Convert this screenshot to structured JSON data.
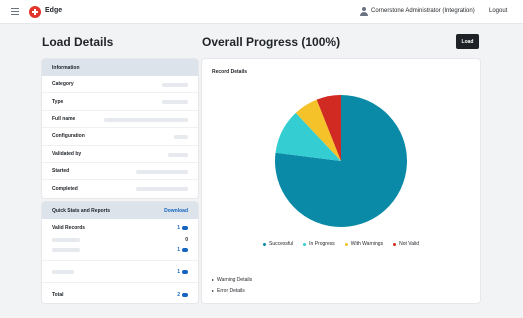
{
  "header": {
    "brand": "Edge",
    "user": "Cornerstone Administrator (Integration)",
    "logout": "Logout"
  },
  "page": {
    "title": "Load Details",
    "progress_title": "Overall Progress (100%)",
    "load_button": "Load"
  },
  "information": {
    "title": "Information",
    "rows": [
      {
        "label": "Category"
      },
      {
        "label": "Type"
      },
      {
        "label": "Full name"
      },
      {
        "label": "Configuration"
      },
      {
        "label": "Validated by"
      },
      {
        "label": "Started"
      },
      {
        "label": "Completed"
      }
    ]
  },
  "stats": {
    "title": "Quick Stats and Reports",
    "download": "Download",
    "valid_records_label": "Valid Records",
    "valid_records_value": "1",
    "row2_value": "0",
    "row3_value": "1",
    "row4_value": "1",
    "total_label": "Total",
    "total_value": "2"
  },
  "record_details": {
    "title": "Record Details",
    "warning_details": "Warning Details",
    "error_details": "Error Details"
  },
  "colors": {
    "successful": "#0a8aa6",
    "in_progress": "#33cdd2",
    "with_warnings": "#f6c229",
    "not_valid": "#d12a22"
  },
  "chart_data": {
    "type": "pie",
    "title": "Record Details",
    "legend_position": "bottom",
    "series": [
      {
        "name": "Successful",
        "value": 77,
        "color": "#0a8aa6"
      },
      {
        "name": "In Progress",
        "value": 11,
        "color": "#33cdd2"
      },
      {
        "name": "With Warnings",
        "value": 6,
        "color": "#f6c229"
      },
      {
        "name": "Not Valid",
        "value": 6,
        "color": "#d12a22"
      }
    ]
  }
}
